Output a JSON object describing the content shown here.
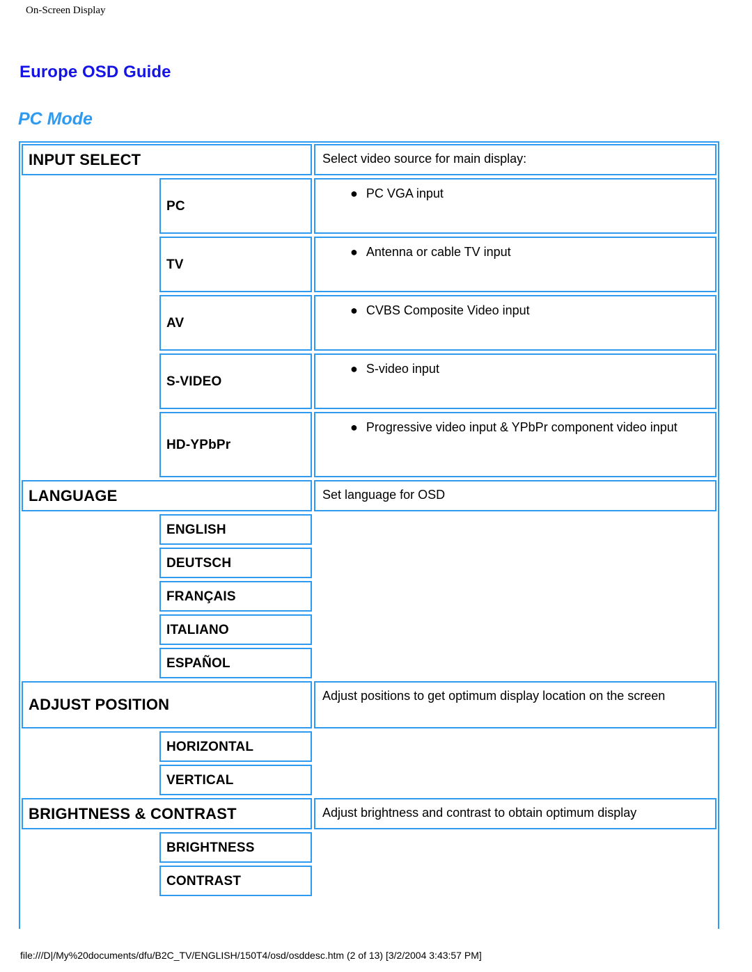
{
  "running_header": "On-Screen Display",
  "title": "Europe OSD Guide",
  "subtitle": "PC Mode",
  "colors": {
    "border": "#2e9bf0",
    "title": "#1414e6",
    "subtitle": "#2e9bf0",
    "text": "#000000"
  },
  "bullet_glyph": "●",
  "sections": [
    {
      "header": "INPUT SELECT",
      "description": "Select video source for main display:",
      "items": [
        {
          "label": "PC",
          "bullet": "PC VGA input"
        },
        {
          "label": "TV",
          "bullet": "Antenna or cable TV input"
        },
        {
          "label": "AV",
          "bullet": "CVBS Composite Video input"
        },
        {
          "label": "S-VIDEO",
          "bullet": "S-video input"
        },
        {
          "label": "HD-YPbPr",
          "bullet": "Progressive video input & YPbPr component video input"
        }
      ]
    },
    {
      "header": "LANGUAGE",
      "description": "Set language for OSD",
      "items": [
        {
          "label": "ENGLISH",
          "bullet": ""
        },
        {
          "label": "DEUTSCH",
          "bullet": ""
        },
        {
          "label": "FRANÇAIS",
          "bullet": ""
        },
        {
          "label": "ITALIANO",
          "bullet": ""
        },
        {
          "label": "ESPAÑOL",
          "bullet": ""
        }
      ]
    },
    {
      "header": "ADJUST POSITION",
      "description": "Adjust positions to get optimum display location on the screen",
      "items": [
        {
          "label": "HORIZONTAL",
          "bullet": ""
        },
        {
          "label": "VERTICAL",
          "bullet": ""
        }
      ]
    },
    {
      "header": "BRIGHTNESS & CONTRAST",
      "description": "Adjust brightness and contrast to obtain optimum display",
      "items": [
        {
          "label": "BRIGHTNESS",
          "bullet": ""
        },
        {
          "label": "CONTRAST",
          "bullet": ""
        }
      ]
    }
  ],
  "footer": "file:///D|/My%20documents/dfu/B2C_TV/ENGLISH/150T4/osd/osddesc.htm (2 of 13) [3/2/2004 3:43:57 PM]"
}
